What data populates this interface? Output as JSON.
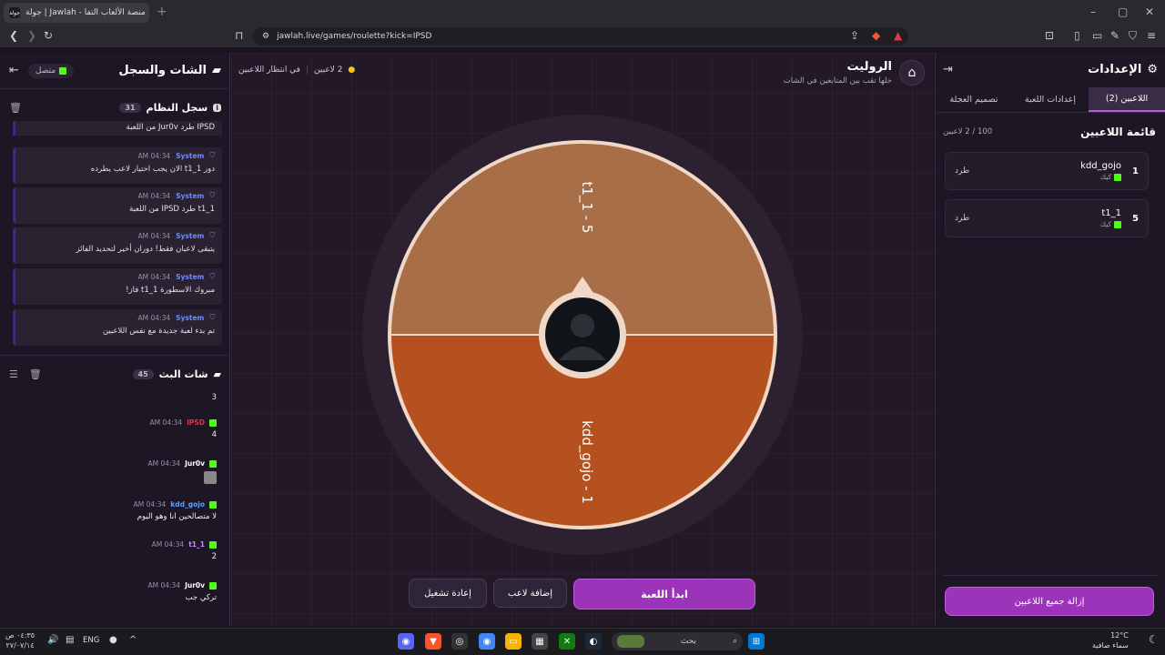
{
  "browser": {
    "tab_title": "جولة | Jawlah - منصة الألعاب التفا",
    "favicon_text": "جولة",
    "url": "jawlah.live/games/roulette?kick=IPSD"
  },
  "chat_panel": {
    "title": "الشات والسجل",
    "status": "متصل",
    "system_log": {
      "title": "سجل النظام",
      "count": "31",
      "first_text": "IPSD طرد Jur0v من اللعبة",
      "messages": [
        {
          "who": "System",
          "time": "04:34 AM",
          "text": "دور t1_1 الان يجب اختيار لاعب يطرده"
        },
        {
          "who": "System",
          "time": "04:34 AM",
          "text": "t1_1 طرد IPSD من اللعبة"
        },
        {
          "who": "System",
          "time": "04:34 AM",
          "text": "يتبقى لاعبان فقط! دوران أخير لتحديد الفائز"
        },
        {
          "who": "System",
          "time": "04:34 AM",
          "text": "مبروك الاسطورة t1_1 فاز!"
        },
        {
          "who": "System",
          "time": "04:34 AM",
          "text": "تم بدء لعبة جديدة مع نفس اللاعبين"
        }
      ]
    },
    "stream_chat": {
      "title": "شات البث",
      "count": "45",
      "first_text": "3",
      "messages": [
        {
          "user": "IPSD",
          "time": "04:34 AM",
          "text": "4",
          "color": "#e0364a"
        },
        {
          "user": "Jur0v",
          "time": "04:34 AM",
          "text": "",
          "color": "#ffffff"
        },
        {
          "user": "kdd_gojo",
          "time": "04:34 AM",
          "text": "لا متصالحين انا وهو اليوم",
          "color": "#5aa0ff"
        },
        {
          "user": "t1_1",
          "time": "04:34 AM",
          "text": "2",
          "color": "#c88cff"
        },
        {
          "user": "Jur0v",
          "time": "04:34 AM",
          "text": "تركي جب",
          "color": "#ffffff"
        }
      ]
    }
  },
  "game": {
    "title": "الروليت",
    "subtitle": "خلها تقب بين المتابعين في الشات",
    "players_count": "2 لاعبين",
    "waiting": "في انتظار اللاعبين",
    "wheel": {
      "segments": [
        {
          "label": "t1_1 - 5",
          "color": "#a86e47"
        },
        {
          "label": "kdd_gojo - 1",
          "color": "#b5511f"
        }
      ]
    },
    "start_label": "ابدأ اللعبة",
    "add_label": "إضافة لاعب",
    "restart_label": "إعادة تشغيل"
  },
  "settings": {
    "title": "الإعدادات",
    "tabs": [
      "اللاعبين (2)",
      "إعدادات اللعبة",
      "تصميم العجلة"
    ],
    "list_title": "قائمة اللاعبين",
    "list_count": "100 / 2 لاعبين",
    "players": [
      {
        "num": "1",
        "name": "kdd_gojo",
        "platform": "كيك",
        "kick_label": "طرد"
      },
      {
        "num": "5",
        "name": "t1_1",
        "platform": "كيك",
        "kick_label": "طرد"
      }
    ],
    "remove_all_label": "إزالة جميع اللاعبين"
  },
  "taskbar": {
    "search_placeholder": "بحث",
    "lang": "ENG",
    "time": "٠٤:٣٥ ص",
    "date": "٢٧/٠٧/١٤",
    "temp": "12°C",
    "weather": "سماء صافية"
  }
}
